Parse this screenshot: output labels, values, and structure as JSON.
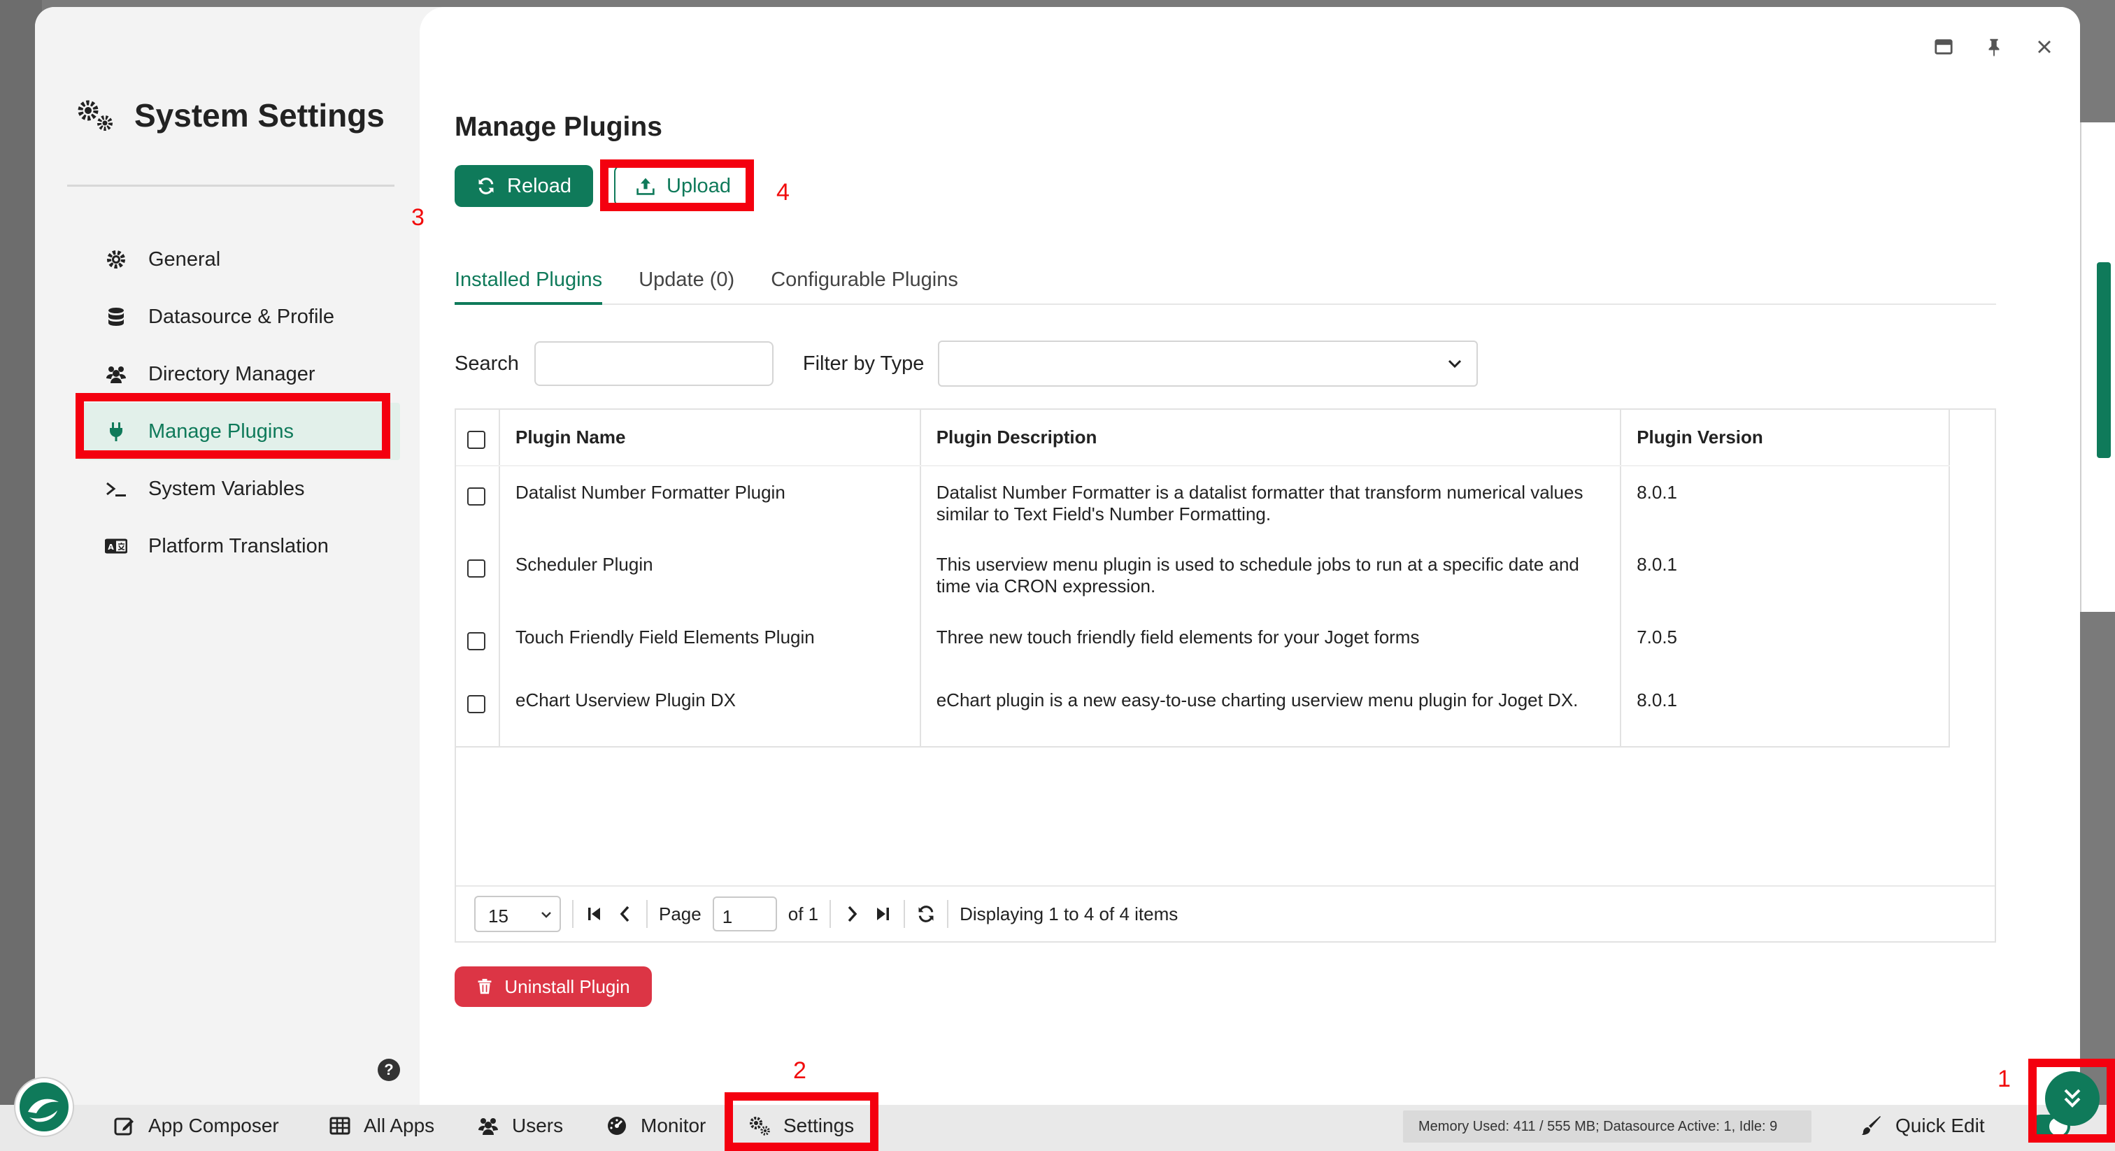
{
  "sidebar": {
    "title": "System Settings",
    "items": [
      {
        "label": "General"
      },
      {
        "label": "Datasource & Profile"
      },
      {
        "label": "Directory Manager"
      },
      {
        "label": "Manage Plugins"
      },
      {
        "label": "System Variables"
      },
      {
        "label": "Platform Translation"
      }
    ],
    "help": "?"
  },
  "main": {
    "title": "Manage Plugins",
    "reload_label": "Reload",
    "upload_label": "Upload",
    "tabs": [
      {
        "label": "Installed Plugins"
      },
      {
        "label": "Update (0)"
      },
      {
        "label": "Configurable Plugins"
      }
    ],
    "search_label": "Search",
    "search_value": "",
    "filter_label": "Filter by Type",
    "filter_value": "",
    "table": {
      "headers": [
        "Plugin Name",
        "Plugin Description",
        "Plugin Version"
      ],
      "rows": [
        {
          "name": "Datalist Number Formatter Plugin",
          "desc": "Datalist Number Formatter is a datalist formatter that transform numerical values similar to Text Field's Number Formatting.",
          "version": "8.0.1"
        },
        {
          "name": "Scheduler Plugin",
          "desc": "This userview menu plugin is used to schedule jobs to run at a specific date and time via CRON expression.",
          "version": "8.0.1"
        },
        {
          "name": "Touch Friendly Field Elements Plugin",
          "desc": "Three new touch friendly field elements for your Joget forms",
          "version": "7.0.5"
        },
        {
          "name": "eChart Userview Plugin DX",
          "desc": "eChart plugin is a new easy-to-use charting userview menu plugin for Joget DX.",
          "version": "8.0.1"
        }
      ]
    },
    "pager": {
      "page_size": "15",
      "page_label": "Page",
      "page_value": "1",
      "of_label": "of 1",
      "display_text": "Displaying 1 to 4 of 4 items"
    },
    "uninstall_label": "Uninstall Plugin"
  },
  "taskbar": {
    "items": [
      {
        "label": "App Composer"
      },
      {
        "label": "All Apps"
      },
      {
        "label": "Users"
      },
      {
        "label": "Monitor"
      },
      {
        "label": "Settings"
      }
    ],
    "memory_text": "Memory Used: 411 / 555 MB; Datasource Active: 1, Idle: 9",
    "quick_edit_label": "Quick Edit"
  },
  "annotations": [
    "1",
    "2",
    "3",
    "4"
  ],
  "colors": {
    "accent": "#0f7a5a",
    "danger": "#dc3545",
    "highlight": "#f4000f"
  }
}
